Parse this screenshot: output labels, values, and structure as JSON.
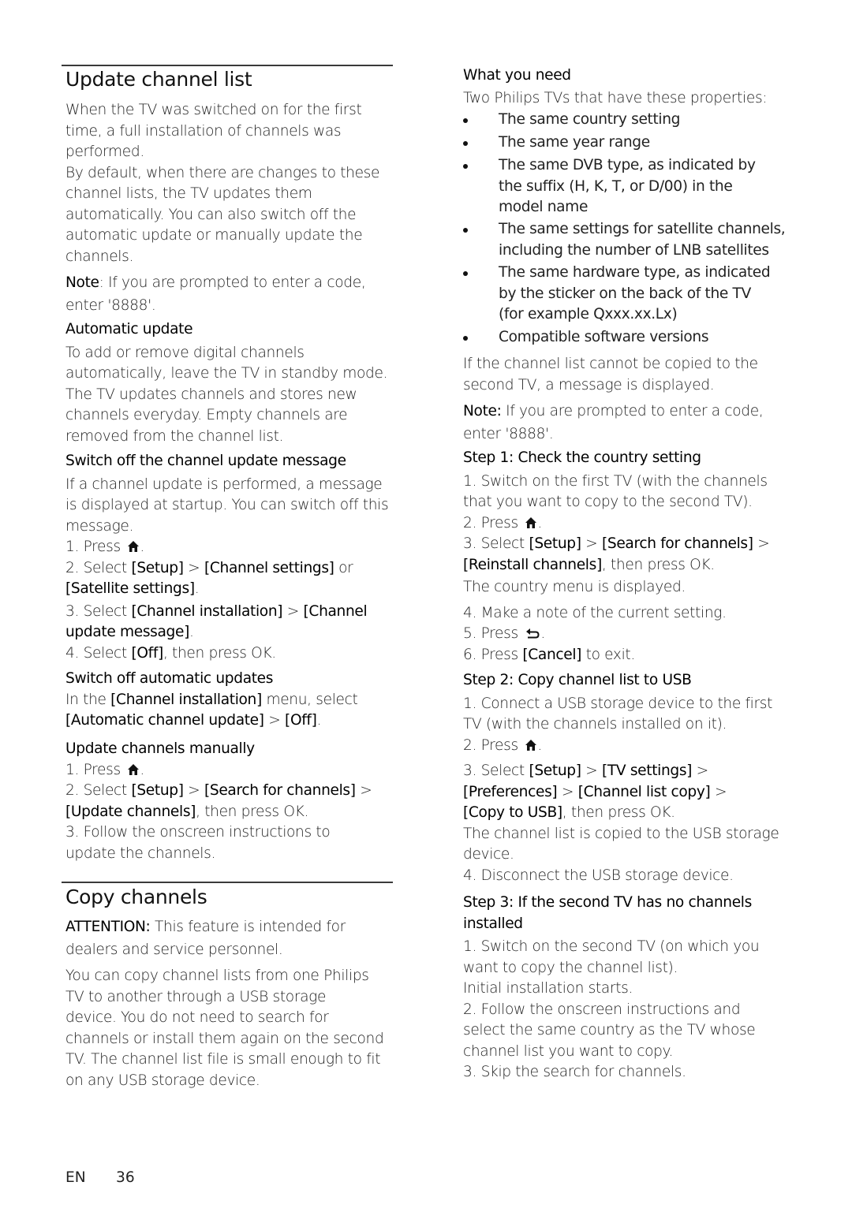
{
  "left": {
    "update": {
      "title": "Update channel list",
      "intro": [
        "When the TV was switched on for the first",
        "time, a full installation of channels was",
        "performed.",
        "By default, when there are changes to these",
        "channel lists, the TV updates them",
        "automatically. You can also switch off the",
        "automatic update or manually update the",
        "channels."
      ],
      "note_label": "Note",
      "note_rest": ": If you are prompted to enter a code,",
      "note_line2": "enter '8888'.",
      "auto_heading": "Automatic update",
      "auto_text": [
        "To add or remove digital channels",
        "automatically, leave the TV in standby mode.",
        "The TV updates channels and stores new",
        "channels everyday. Empty channels are",
        "removed from the channel list."
      ],
      "msg_heading": "Switch off the channel update message",
      "msg_text": [
        "If a channel update is performed, a message",
        "is displayed at startup. You can switch off this",
        "message."
      ],
      "msg_step1": "1. Press ",
      "msg_step2a": "2. Select ",
      "msg_step2_setup": "[Setup]",
      "msg_step2_gt": " > ",
      "msg_step2_chset": "[Channel settings]",
      "msg_step2_or": " or",
      "msg_step2_sat": "[Satellite settings]",
      "msg_step3a": "3. Select ",
      "msg_step3_inst": "[Channel installation]",
      "msg_step3_gt": " > ",
      "msg_step3_msg1": "[Channel",
      "msg_step3_msg2": "update message]",
      "msg_step4a": "4. Select ",
      "msg_step4_off": "[Off]",
      "msg_step4b": ", then press OK.",
      "autooff_heading": "Switch off automatic updates",
      "autooff_a": "In the ",
      "autooff_inst": "[Channel installation]",
      "autooff_b": " menu, select",
      "autooff_auto": "[Automatic channel update]",
      "autooff_gt": " > ",
      "autooff_off": "[Off]",
      "manual_heading": "Update channels manually",
      "manual_step1": "1. Press ",
      "manual_step2a": "2. Select ",
      "manual_setup": "[Setup]",
      "manual_gt": " > ",
      "manual_search": "[Search for channels]",
      "manual_gt2": " >",
      "manual_update": "[Update channels]",
      "manual_step2b": ", then press OK.",
      "manual_step3": [
        "3. Follow the onscreen instructions to",
        "update the channels."
      ]
    },
    "copy": {
      "title": "Copy channels",
      "attention_label": "ATTENTION:",
      "attention_rest": " This feature is intended for",
      "attention_line2": "dealers and service personnel.",
      "intro": [
        "You can copy channel lists from one Philips",
        "TV to another through a USB storage",
        "device. You do not need to search for",
        "channels or install them again on the second",
        "TV. The channel list file is small enough to fit",
        "on any USB storage device."
      ]
    }
  },
  "right": {
    "need_heading": "What you need",
    "need_intro": "Two Philips TVs that have these properties:",
    "bullets": [
      [
        "The same country setting"
      ],
      [
        "The same year range"
      ],
      [
        "The same DVB type, as indicated by",
        "the suffix (H, K, T, or D/00) in the",
        "model name"
      ],
      [
        "The same settings for satellite channels,",
        "including the number of LNB satellites"
      ],
      [
        "The same hardware type, as indicated",
        "by the sticker on the back of the TV",
        "(for example Qxxx.xx.Lx)"
      ],
      [
        "Compatible software versions"
      ]
    ],
    "fail_text": [
      "If the channel list cannot be copied to the",
      "second TV, a message is displayed."
    ],
    "note_label": "Note:",
    "note_rest": " If you are prompted to enter a code,",
    "note_line2": "enter '8888'.",
    "step1": {
      "heading": "Step 1: Check the country setting",
      "s1": [
        "1. Switch on the first TV (with the channels",
        "that you want to copy to the second TV)."
      ],
      "s2": "2. Press ",
      "s3a": "3. Select ",
      "setup": "[Setup]",
      "gt": " > ",
      "search": "[Search for channels]",
      "gt2": " >",
      "reinstall": "[Reinstall channels]",
      "s3b": ", then press OK.",
      "country": "The country menu is displayed.",
      "s4": "4. Make a note of the current setting.",
      "s5": "5. Press ",
      "s6a": "6. Press ",
      "cancel": "[Cancel]",
      "s6b": " to exit."
    },
    "step2": {
      "heading": "Step 2: Copy channel list to USB",
      "s1": [
        "1. Connect a USB storage device to the first",
        "TV (with the channels installed on it)."
      ],
      "s2": "2. Press ",
      "s3a": "3. Select ",
      "setup": "[Setup]",
      "gt": " > ",
      "tvset": "[TV settings]",
      "gt2": " >",
      "prefs": "[Preferences]",
      "gt3": " > ",
      "copy": "[Channel list copy]",
      "gt4": " >",
      "tousb": "[Copy to USB]",
      "s3b": ", then press OK.",
      "copied": [
        "The channel list is copied to the USB storage",
        "device."
      ],
      "s4": "4. Disconnect the USB storage device."
    },
    "step3": {
      "heading": [
        "Step 3: If the second TV has no channels",
        "installed"
      ],
      "lines": [
        "1. Switch on the second TV (on which you",
        "want to copy the channel list).",
        "Initial installation starts.",
        "2. Follow the onscreen instructions and",
        "select the same country as the TV whose",
        "channel list you want to copy.",
        "3. Skip the search for channels."
      ]
    }
  },
  "footer": {
    "lang": "EN",
    "page": "36"
  },
  "icons": {
    "home": "home-icon",
    "back": "back-icon"
  }
}
